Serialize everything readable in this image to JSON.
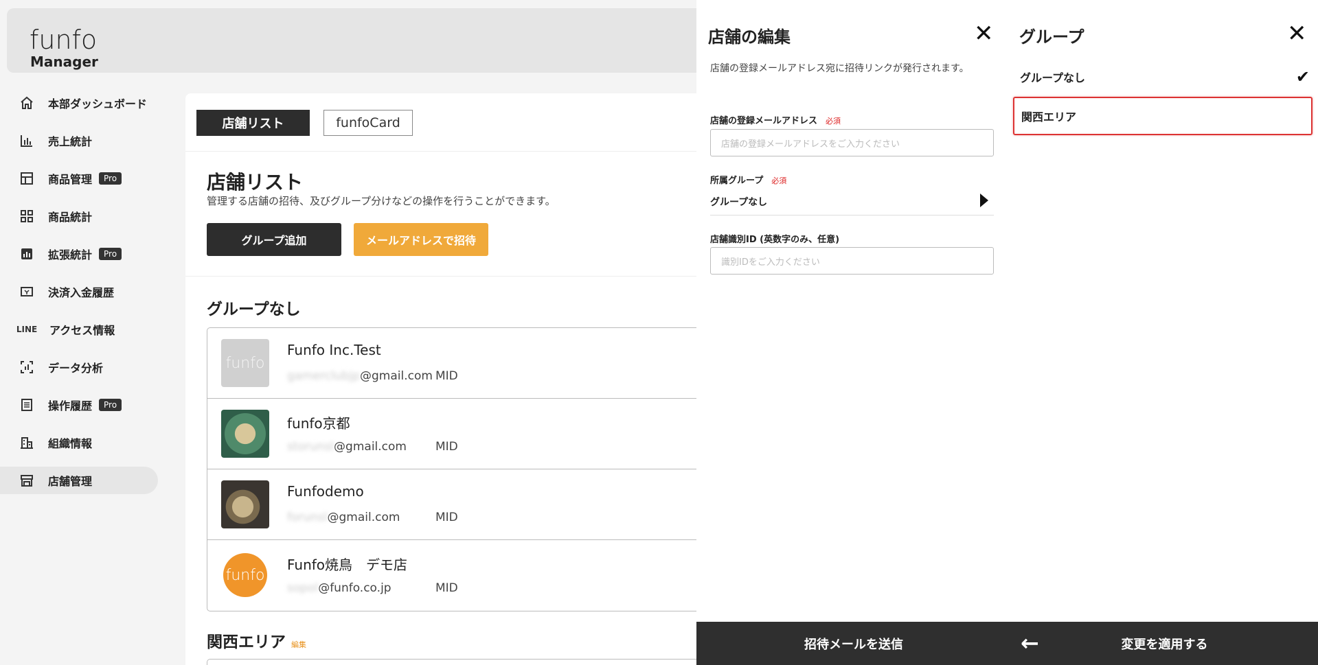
{
  "brand": {
    "logo": "funfo",
    "subtitle": "Manager"
  },
  "sidebar": {
    "items": [
      {
        "label": "本部ダッシュボード",
        "icon": "home-icon",
        "pro": false,
        "active": false
      },
      {
        "label": "売上統計",
        "icon": "bar-chart-icon",
        "pro": false,
        "active": false
      },
      {
        "label": "商品管理",
        "icon": "layout-icon",
        "pro": true,
        "active": false
      },
      {
        "label": "商品統計",
        "icon": "grid-icon",
        "pro": false,
        "active": false
      },
      {
        "label": "拡張統計",
        "icon": "chart-box-icon",
        "pro": true,
        "active": false
      },
      {
        "label": "決済入金履歴",
        "icon": "payment-icon",
        "pro": false,
        "active": false
      },
      {
        "label": "アクセス情報",
        "icon": "line-icon",
        "icon_text": "LINE",
        "pro": false,
        "active": false
      },
      {
        "label": "データ分析",
        "icon": "analysis-icon",
        "pro": false,
        "active": false
      },
      {
        "label": "操作履歴",
        "icon": "list-icon",
        "pro": true,
        "active": false
      },
      {
        "label": "組織情報",
        "icon": "building-icon",
        "pro": false,
        "active": false
      },
      {
        "label": "店舗管理",
        "icon": "store-icon",
        "pro": false,
        "active": true
      }
    ],
    "pro_label": "Pro"
  },
  "main": {
    "tabs": [
      "店舗リスト",
      "funfoCard"
    ],
    "title": "店舗リスト",
    "description": "管理する店舗の招待、及びグループ分けなどの操作を行うことができます。",
    "add_group_button": "グループ追加",
    "invite_button": "メールアドレスで招待",
    "group1_title": "グループなし",
    "stores": [
      {
        "name": "Funfo Inc.Test",
        "email_hidden": "gamerclubjp",
        "email_domain": "@gmail.com",
        "mid": "MID",
        "thumb": "gray",
        "thumb_text": "funfo"
      },
      {
        "name": "funfo京都",
        "email_hidden": "storunsl",
        "email_domain": "@gmail.com",
        "mid": "MID",
        "thumb": "food1",
        "thumb_text": ""
      },
      {
        "name": "Funfodemo",
        "email_hidden": "forunsl",
        "email_domain": "@gmail.com",
        "mid": "MID",
        "thumb": "food2",
        "thumb_text": ""
      },
      {
        "name": "Funfo焼鳥　デモ店",
        "email_hidden": "sopol",
        "email_domain": "@funfo.co.jp",
        "mid": "MID",
        "thumb": "orange",
        "thumb_text": "funfo"
      }
    ],
    "group2_title": "関西エリア",
    "group2_edit": "編集"
  },
  "edit_panel": {
    "title": "店舗の編集",
    "description": "店舗の登録メールアドレス宛に招待リンクが発行されます。",
    "email_label": "店舗の登録メールアドレス",
    "required": "必須",
    "email_placeholder": "店舗の登録メールアドレスをご入力ください",
    "group_label": "所属グループ",
    "group_value": "グループなし",
    "id_label": "店舗識別ID (英数字のみ、任意)",
    "id_placeholder": "識別IDをご入力ください",
    "submit": "招待メールを送信"
  },
  "group_panel": {
    "title": "グループ",
    "options": [
      "グループなし",
      "関西エリア"
    ],
    "apply": "変更を適用する"
  },
  "colors": {
    "accent": "#f0a93a",
    "dark": "#2d2d2d",
    "required": "#dd2222",
    "highlight": "#dd3333"
  }
}
